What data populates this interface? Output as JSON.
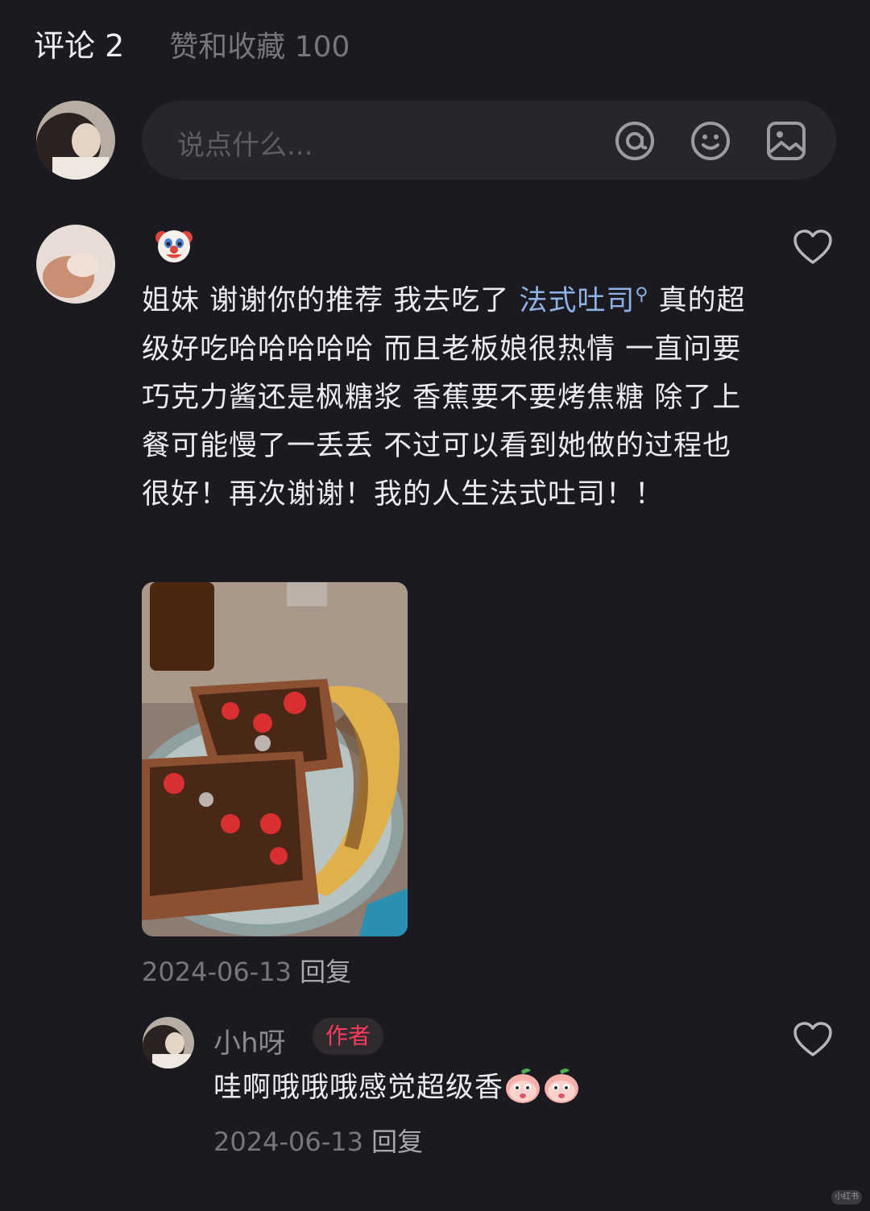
{
  "tabs": {
    "comments_label": "评论 2",
    "likes_label": "赞和收藏 100"
  },
  "input": {
    "placeholder": "说点什么..."
  },
  "icons": {
    "mention": "at-icon",
    "emoji": "smile-icon",
    "image": "image-icon",
    "like": "heart-outline-icon",
    "reaction_emoji": "clown-face-icon",
    "sticker": "peach-sticker-icon"
  },
  "comment": {
    "text_before_tag": "姐妹 谢谢你的推荐 我去吃了 ",
    "tag": "法式吐司",
    "text_after_tag": " 真的超级好吃哈哈哈哈哈 而且老板娘很热情 一直问要巧克力酱还是枫糖浆 香蕉要不要烤焦糖 除了上餐可能慢了一丢丢 不过可以看到她做的过程也很好！再次谢谢！我的人生法式吐司！！",
    "date": "2024-06-13",
    "reply_label": "回复"
  },
  "reply": {
    "username": "小h呀",
    "badge": "作者",
    "text": "哇啊哦哦哦感觉超级香",
    "date": "2024-06-13",
    "reply_label": "回复"
  },
  "watermark": "小红书",
  "colors": {
    "background": "#1b1a20",
    "tag_blue": "#8fb2e6",
    "author_badge": "#ff3b5c"
  }
}
